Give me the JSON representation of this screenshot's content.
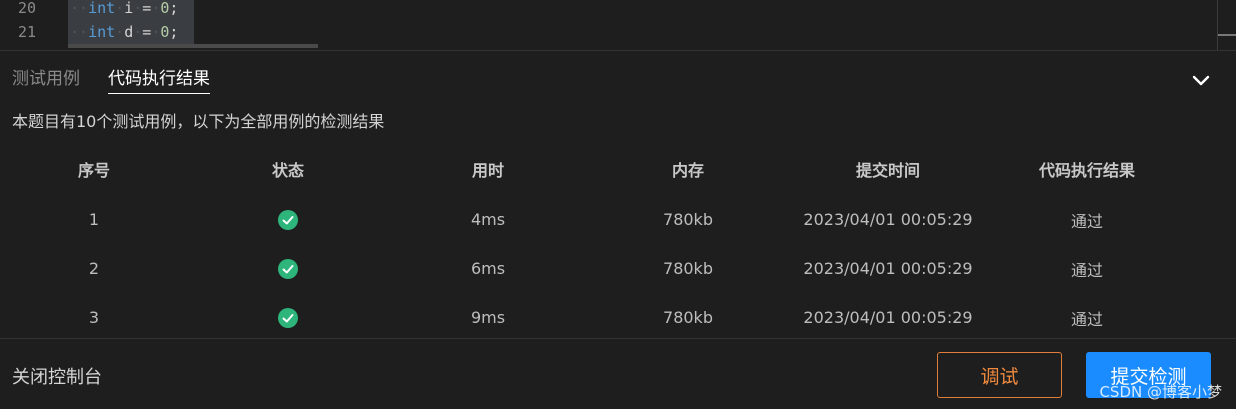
{
  "editor": {
    "lines": [
      {
        "number": "20",
        "keyword": "int",
        "name": "i",
        "op": "=",
        "value": "0",
        "end": ";"
      },
      {
        "number": "21",
        "keyword": "int",
        "name": "d",
        "op": "=",
        "value": "0",
        "end": ";"
      }
    ]
  },
  "console": {
    "tabs": [
      {
        "label": "测试用例",
        "active": false
      },
      {
        "label": "代码执行结果",
        "active": true
      }
    ],
    "collapse_icon": "chevron-down-icon",
    "summary": "本题目有10个测试用例，以下为全部用例的检测结果",
    "table": {
      "headers": [
        "序号",
        "状态",
        "用时",
        "内存",
        "提交时间",
        "代码执行结果"
      ],
      "rows": [
        {
          "index": "1",
          "status": "check-circle-icon",
          "time": "4ms",
          "memory": "780kb",
          "submitted": "2023/04/01 00:05:29",
          "result": "通过"
        },
        {
          "index": "2",
          "status": "check-circle-icon",
          "time": "6ms",
          "memory": "780kb",
          "submitted": "2023/04/01 00:05:29",
          "result": "通过"
        },
        {
          "index": "3",
          "status": "check-circle-icon",
          "time": "9ms",
          "memory": "780kb",
          "submitted": "2023/04/01 00:05:29",
          "result": "通过"
        }
      ]
    }
  },
  "footer": {
    "close_label": "关闭控制台",
    "debug_label": "调试",
    "submit_label": "提交检测",
    "watermark": "CSDN @博客小梦"
  },
  "colors": {
    "background": "#1e1e1e",
    "keyword": "#569cd6",
    "number": "#b5cea8",
    "success": "#2db57c",
    "debug_accent": "#f08a3f",
    "submit_bg": "#1a8cff"
  }
}
